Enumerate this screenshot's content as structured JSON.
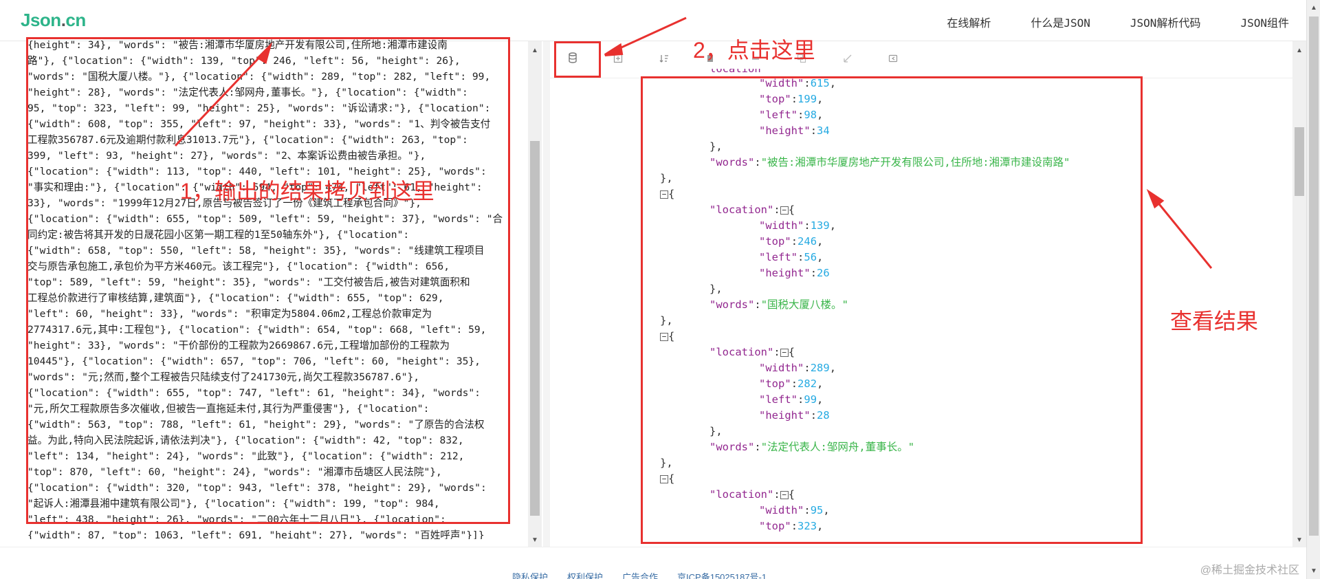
{
  "header": {
    "logo_main": "Json",
    "logo_dot": ".",
    "logo_tld": "cn",
    "nav": [
      "在线解析",
      "什么是JSON",
      "JSON解析代码",
      "JSON组件"
    ]
  },
  "left_editor": {
    "lines": [
      "{height\": 34}, \"words\": \"被告:湘潭市华厦房地产开发有限公司,住所地:湘潭市建设南",
      "路\"}, {\"location\": {\"width\": 139, \"top\": 246, \"left\": 56, \"height\": 26},",
      "\"words\": \"国税大厦八楼。\"}, {\"location\": {\"width\": 289, \"top\": 282, \"left\": 99,",
      "\"height\": 28}, \"words\": \"法定代表人:邹网舟,董事长。\"}, {\"location\": {\"width\":",
      "95, \"top\": 323, \"left\": 99, \"height\": 25}, \"words\": \"诉讼请求:\"}, {\"location\":",
      "{\"width\": 608, \"top\": 355, \"left\": 97, \"height\": 33}, \"words\": \"1、判令被告支付",
      "工程款356787.6元及逾期付款利息31013.7元\"}, {\"location\": {\"width\": 263, \"top\":",
      "399, \"left\": 93, \"height\": 27}, \"words\": \"2、本案诉讼费由被告承担。\"},",
      "{\"location\": {\"width\": 113, \"top\": 440, \"left\": 101, \"height\": 25}, \"words\":",
      "\"事实和理由:\"}, {\"location\": {\"width\": 594, \"top\": 474, \"left\": 61, \"height\":",
      "33}, \"words\": \"1999年12月27日,原告与被告签订了一份《建筑工程承包合同》\"},",
      "{\"location\": {\"width\": 655, \"top\": 509, \"left\": 59, \"height\": 37}, \"words\": \"合",
      "同约定:被告将其开发的日晟花园小区第一期工程的1至50轴东外\"}, {\"location\":",
      "{\"width\": 658, \"top\": 550, \"left\": 58, \"height\": 35}, \"words\": \"线建筑工程项目",
      "交与原告承包施工,承包价为平方米460元。该工程完\"}, {\"location\": {\"width\": 656,",
      "\"top\": 589, \"left\": 59, \"height\": 35}, \"words\": \"工交付被告后,被告对建筑面积和",
      "工程总价款进行了审核结算,建筑面\"}, {\"location\": {\"width\": 655, \"top\": 629,",
      "\"left\": 60, \"height\": 33}, \"words\": \"积审定为5804.06m2,工程总价款审定为",
      "2774317.6元,其中:工程包\"}, {\"location\": {\"width\": 654, \"top\": 668, \"left\": 59,",
      "\"height\": 33}, \"words\": \"干价部份的工程款为2669867.6元,工程增加部份的工程款为",
      "10445\"}, {\"location\": {\"width\": 657, \"top\": 706, \"left\": 60, \"height\": 35},",
      "\"words\": \"元;然而,整个工程被告只陆续支付了241730元,尚欠工程款356787.6\"},",
      "{\"location\": {\"width\": 655, \"top\": 747, \"left\": 61, \"height\": 34}, \"words\":",
      "\"元,所欠工程款原告多次催收,但被告一直拖延未付,其行为严重侵害\"}, {\"location\":",
      "{\"width\": 563, \"top\": 788, \"left\": 61, \"height\": 29}, \"words\": \"了原告的合法权",
      "益。为此,特向入民法院起诉,请依法判决\"}, {\"location\": {\"width\": 42, \"top\": 832,",
      "\"left\": 134, \"height\": 24}, \"words\": \"此致\"}, {\"location\": {\"width\": 212,",
      "\"top\": 870, \"left\": 60, \"height\": 24}, \"words\": \"湘潭市岳塘区人民法院\"},",
      "{\"location\": {\"width\": 320, \"top\": 943, \"left\": 378, \"height\": 29}, \"words\":",
      "\"起诉人:湘潭县湘中建筑有限公司\"}, {\"location\": {\"width\": 199, \"top\": 984,",
      "\"left\": 438, \"height\": 26}, \"words\": \"二00六年十二月八日\"}, {\"location\":",
      "{\"width\": 87, \"top\": 1063, \"left\": 691, \"height\": 27}, \"words\": \"百姓呼声\"}]}"
    ]
  },
  "toolbar": {
    "icons": [
      "format-icon",
      "compress-icon",
      "sort-icon",
      "copy-icon",
      "clear-icon",
      "expand-icon",
      "collapse-icon",
      "share-icon"
    ]
  },
  "json_view": {
    "partial_top": "location",
    "blocks": [
      {
        "width": "615",
        "top": "199",
        "left": "98",
        "height": "34",
        "words": "被告:湘潭市华厦房地产开发有限公司,住所地:湘潭市建设南路"
      },
      {
        "width": "139",
        "top": "246",
        "left": "56",
        "height": "26",
        "words": "国税大厦八楼。"
      },
      {
        "width": "289",
        "top": "282",
        "left": "99",
        "height": "28",
        "words": "法定代表人:邹网舟,董事长。"
      },
      {
        "width": "95",
        "top": "323"
      }
    ],
    "keys": {
      "location": "location",
      "width": "width",
      "top": "top",
      "left": "left",
      "height": "height",
      "words": "words"
    }
  },
  "footer": {
    "links": [
      "隐私保护",
      "权利保护",
      "广告合作",
      "京ICP备15025187号-1"
    ]
  },
  "watermark": "@稀土掘金技术社区",
  "annotations": {
    "label_1": "1，输出的结果拷贝到这里",
    "label_2": "2，点击这里",
    "label_3": "查看结果",
    "color": "#e8312f"
  },
  "colors": {
    "logo": "#2db48a",
    "json_key": "#92278f",
    "json_number": "#25aae2",
    "json_string": "#3ab54a",
    "annotation": "#e8312f"
  }
}
